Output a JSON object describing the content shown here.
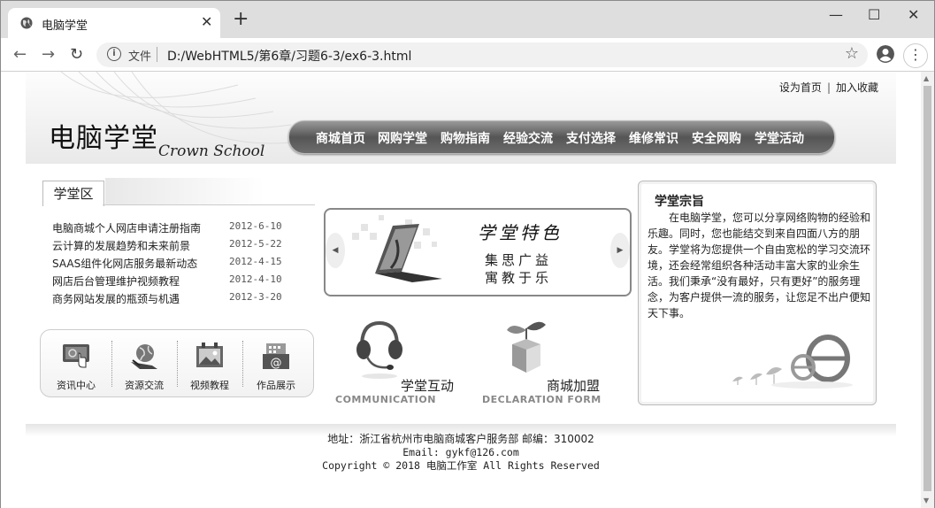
{
  "browser": {
    "tab_title": "电脑学堂",
    "tab_close": "✕",
    "new_tab": "+",
    "controls": {
      "minimize": "—",
      "maximize": "☐",
      "close": "✕"
    },
    "nav": {
      "back": "←",
      "forward": "→",
      "reload": "↻"
    },
    "address": {
      "scheme_label": "文件",
      "url": "D:/WebHTML5/第6章/习题6-3/ex6-3.html",
      "bookmark": "☆"
    },
    "menu": "⋮"
  },
  "header": {
    "top_links": [
      "设为首页",
      "加入收藏"
    ],
    "logo_cn": "电脑学堂",
    "logo_en": "Crown School",
    "nav_items": [
      "商城首页",
      "网购学堂",
      "购物指南",
      "经验交流",
      "支付选择",
      "维修常识",
      "安全网购",
      "学堂活动"
    ]
  },
  "news": {
    "tab_label": "学堂区",
    "items": [
      {
        "title": "电脑商城个人网店申请注册指南",
        "date": "2012-6-10"
      },
      {
        "title": "云计算的发展趋势和未来前景",
        "date": "2012-5-22"
      },
      {
        "title": "SAAS组件化网店服务最新动态",
        "date": "2012-4-15"
      },
      {
        "title": "网店后台管理维护视频教程",
        "date": "2012-4-10"
      },
      {
        "title": "商务网站发展的瓶颈与机遇",
        "date": "2012-3-20"
      }
    ]
  },
  "quicklinks": [
    {
      "label": "资讯中心",
      "icon": "touch-screen-icon"
    },
    {
      "label": "资源交流",
      "icon": "globe-laptop-icon"
    },
    {
      "label": "视频教程",
      "icon": "picture-frame-icon"
    },
    {
      "label": "作品展示",
      "icon": "email-calendar-icon"
    }
  ],
  "banner": {
    "heading": "学堂特色",
    "line1": "集思广益",
    "line2": "寓教于乐",
    "prev": "◀",
    "next": "▶"
  },
  "features": [
    {
      "cn": "学堂互动",
      "en": "COMMUNICATION",
      "icon": "headset-icon"
    },
    {
      "cn": "商城加盟",
      "en": "DECLARATION FORM",
      "icon": "seedling-box-icon"
    }
  ],
  "aim": {
    "title": "学堂宗旨",
    "body": "在电脑学堂，您可以分享网络购物的经验和乐趣。同时，您也能结交到来自四面八方的朋友。学堂将为您提供一个自由宽松的学习交流环境，还会经常组织各种活动丰富大家的业余生活。我们秉承“没有最好，只有更好”的服务理念，为客户提供一流的服务，让您足不出户便知天下事。"
  },
  "footer": {
    "address": "地址：浙江省杭州市电脑商城客户服务部 邮编：310002",
    "email": "Email: gykf@126.com",
    "copyright": "Copyright © 2018 电脑工作室 All Rights Reserved"
  }
}
